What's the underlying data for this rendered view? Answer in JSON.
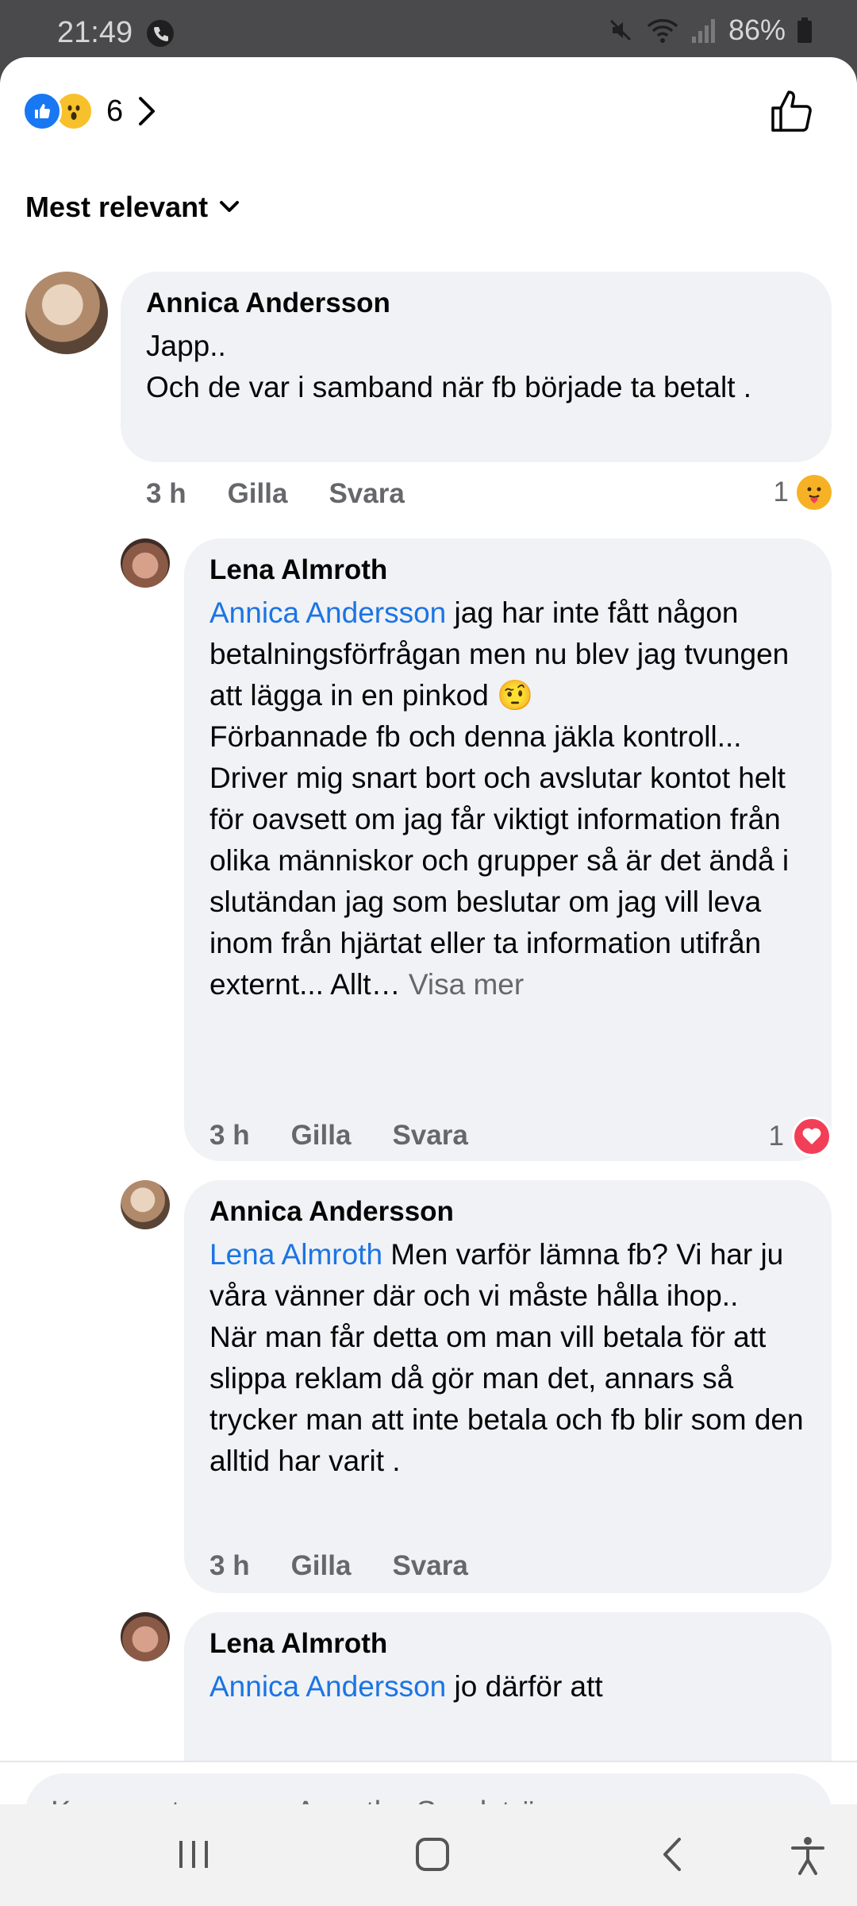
{
  "status_bar": {
    "time": "21:49",
    "battery": "86%"
  },
  "reactions": {
    "count": "6"
  },
  "sort": {
    "label": "Mest relevant"
  },
  "comments": [
    {
      "author": "Annica Andersson",
      "text": "Japp..\nOch de var i samband när fb började ta betalt .",
      "time": "3 h",
      "like_label": "Gilla",
      "reply_label": "Svara",
      "reaction_count": "1"
    },
    {
      "author": "Lena Almroth",
      "mention": "Annica Andersson",
      "text": " jag har inte fått någon betalningsförfrågan men nu blev jag tvungen att lägga in en pinkod 🤨\nFörbannade fb och denna jäkla kontroll...\nDriver mig snart bort och avslutar kontot helt för oavsett om jag får viktigt information från olika människor och grupper så är det ändå i slutändan jag som beslutar om jag vill leva inom från hjärtat eller ta information utifrån externt... Allt…",
      "see_more": " Visa mer",
      "time": "3 h",
      "like_label": "Gilla",
      "reply_label": "Svara",
      "reaction_count": "1"
    },
    {
      "author": "Annica Andersson",
      "mention": "Lena Almroth",
      "text": " Men varför lämna fb? Vi har ju våra vänner där och vi måste hålla ihop..\nNär man får detta om man vill betala för att slippa reklam då gör man det, annars så trycker man att inte betala och fb blir som den alltid har varit .",
      "time": "3 h",
      "like_label": "Gilla",
      "reply_label": "Svara"
    },
    {
      "author": "Lena Almroth",
      "mention": "Annica Andersson",
      "text": " jo därför att"
    }
  ],
  "composer": {
    "placeholder": "Kommentera som Agnetha Sandström"
  }
}
